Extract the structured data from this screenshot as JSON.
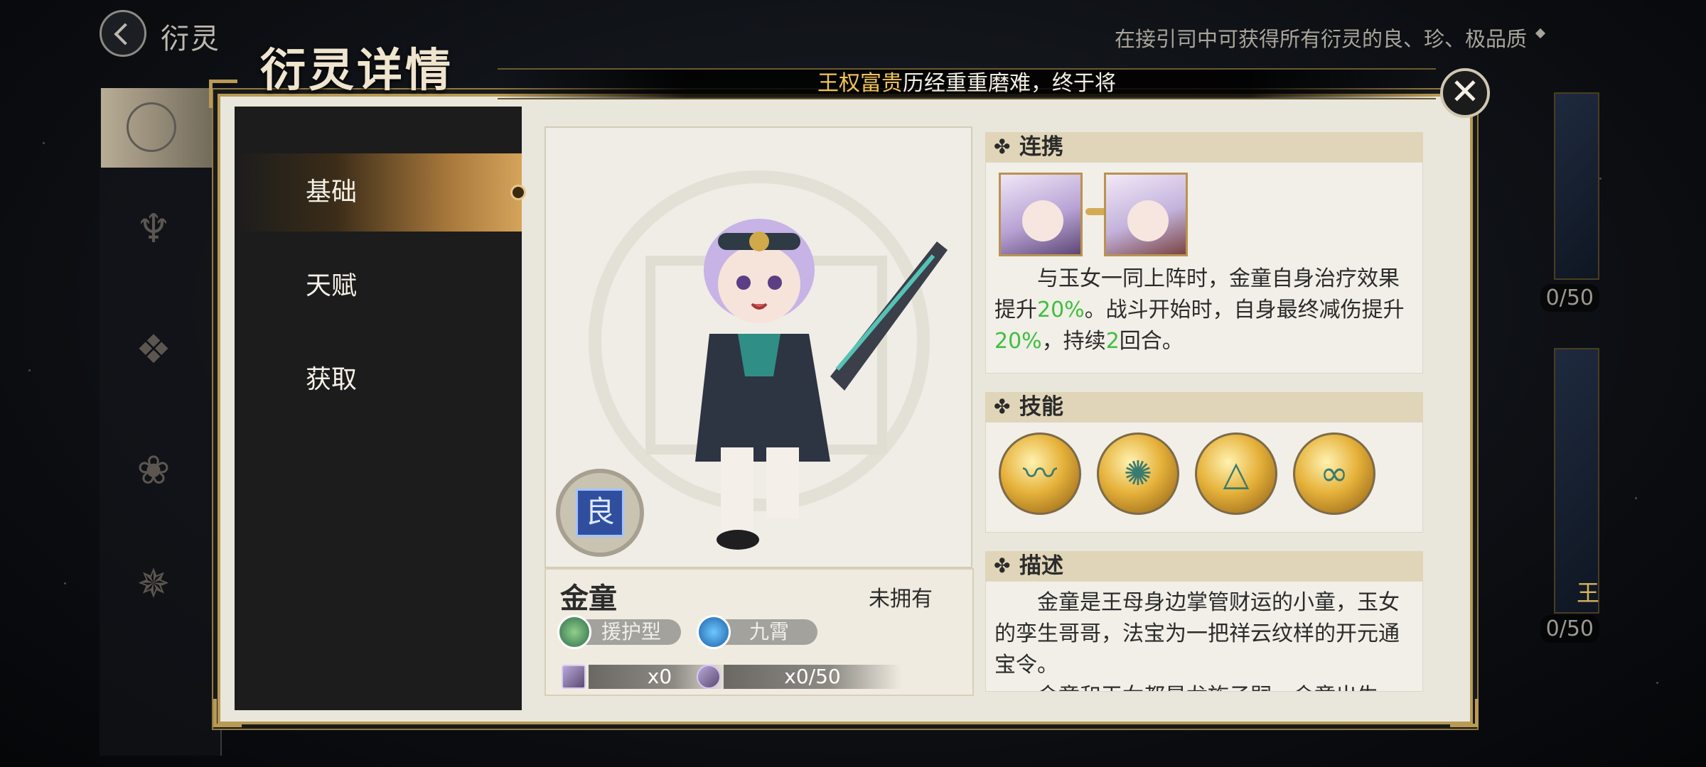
{
  "header": {
    "back_label": "衍灵",
    "hint_text": "在接引司中可获得所有衍灵的良、珍、极品质",
    "page_title": "衍灵详情"
  },
  "banner": {
    "highlight": "王权富贵",
    "text": "历经重重磨难，终于将"
  },
  "tabs": [
    {
      "label": "基础",
      "active": true
    },
    {
      "label": "天赋",
      "active": false
    },
    {
      "label": "获取",
      "active": false
    }
  ],
  "character": {
    "name": "金童",
    "ownership": "未拥有",
    "grade": "良",
    "role": "援护型",
    "faction": "九霄",
    "shard_count": "x0",
    "fragment_progress": "x0/50"
  },
  "sections": {
    "combo": {
      "title": "连携",
      "text_parts": [
        {
          "t": "与玉女一同上阵时，金童自身治疗效果提升",
          "g": false
        },
        {
          "t": "20%",
          "g": true
        },
        {
          "t": "。战斗开始时，自身最终减伤提升",
          "g": false
        },
        {
          "t": "20%",
          "g": true
        },
        {
          "t": "，持续",
          "g": false
        },
        {
          "t": "2",
          "g": true
        },
        {
          "t": "回合。",
          "g": false
        }
      ]
    },
    "skills": {
      "title": "技能",
      "icons": [
        "coin-string-icon",
        "coin-burst-icon",
        "coin-triangle-icon",
        "coin-chain-icon"
      ]
    },
    "description": {
      "title": "描述",
      "text": "金童是王母身边掌管财运的小童，玉女的孪生哥哥，法宝为一把祥云纹样的开元通宝令。",
      "text_cut": "金童和玉女都是龙族子嗣，金童出生"
    }
  },
  "background": {
    "peek_counts": [
      "0/50",
      "0/50"
    ],
    "peek_name_fragment": "王"
  },
  "colors": {
    "gold_accent": "#b89a55",
    "highlight_green": "#3fbf3f",
    "banner_highlight": "#f2c45a"
  }
}
